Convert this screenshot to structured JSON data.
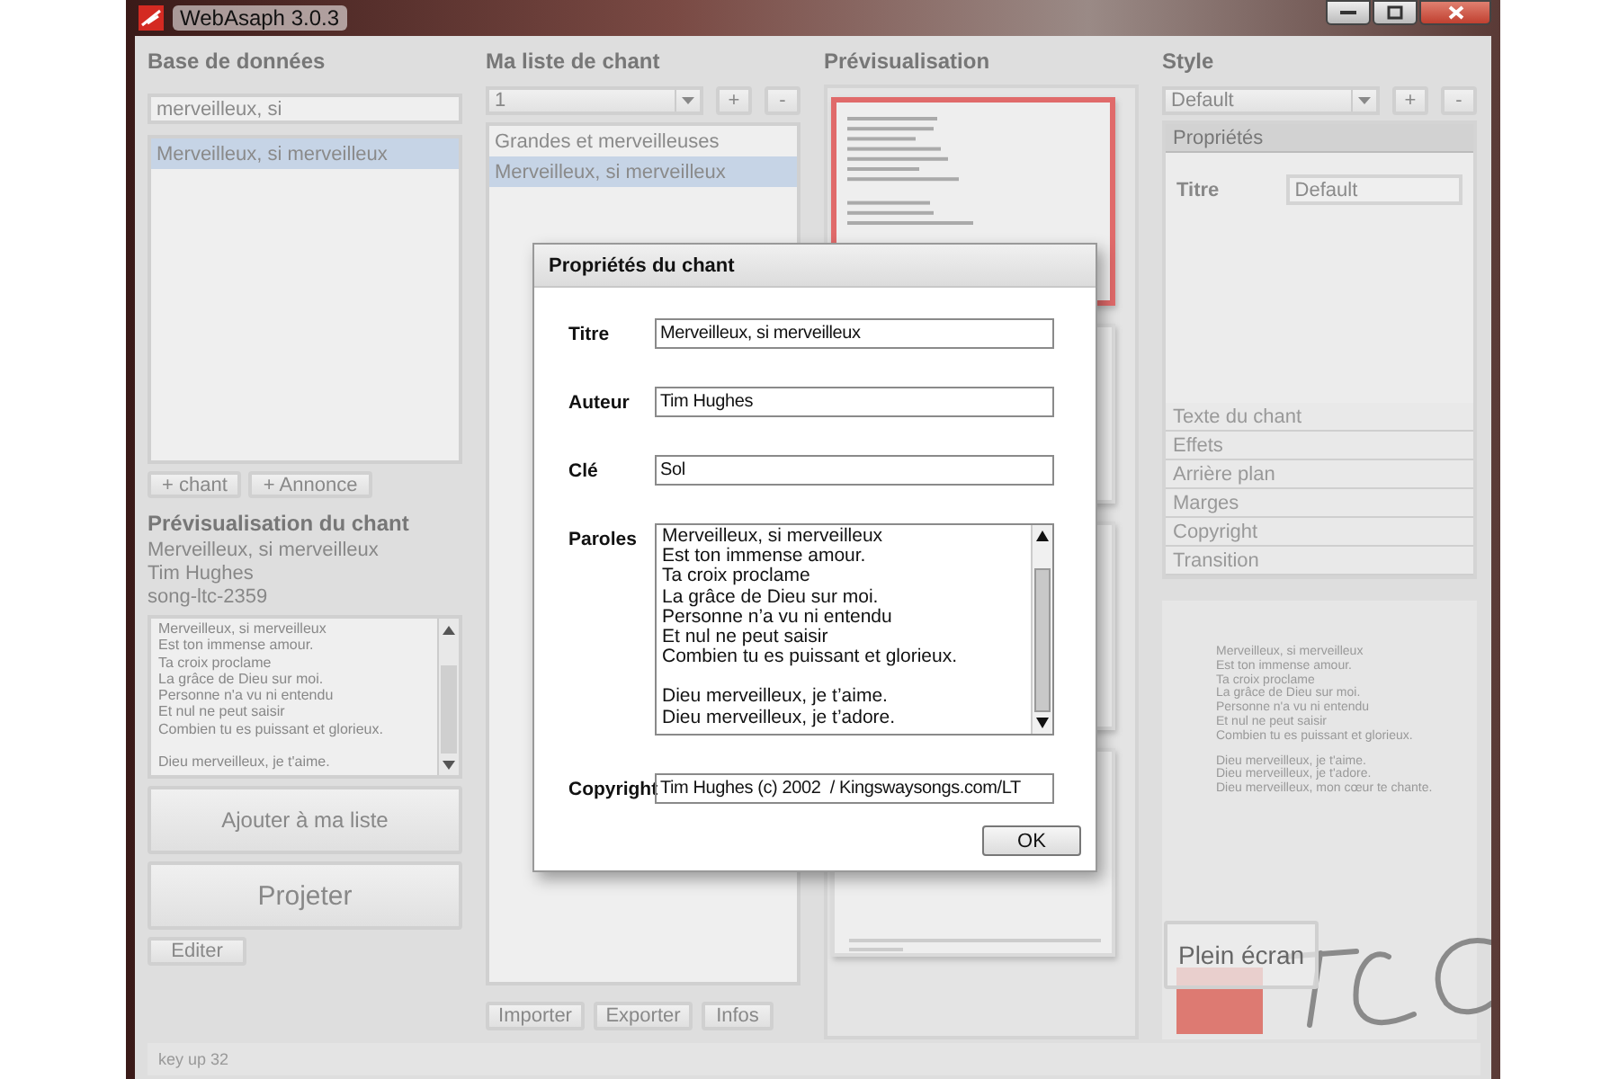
{
  "window": {
    "title": "WebAsaph 3.0.3"
  },
  "database": {
    "heading": "Base de données",
    "search": {
      "value": "merveilleux, si"
    },
    "results": [
      {
        "label": "Merveilleux, si merveilleux",
        "selected": true
      }
    ],
    "buttons": [
      "+ chant",
      "+ Annonce"
    ]
  },
  "song_preview": {
    "heading": "Prévisualisation du chant",
    "title": "Merveilleux, si merveilleux",
    "author": "Tim Hughes",
    "reference": "song-ltc-2359",
    "lyrics": [
      [
        "Merveilleux, si merveilleux",
        "Est ton immense amour.",
        "Ta croix proclame",
        "La grâce de Dieu sur moi.",
        "Personne n'a vu ni entendu",
        "Et nul ne peut saisir",
        "Combien tu es puissant et glorieux."
      ],
      [
        "Dieu merveilleux, je t'aime."
      ]
    ]
  },
  "actions": {
    "add": "Ajouter à ma liste",
    "project": "Projeter",
    "edit": "Editer"
  },
  "setlist": {
    "heading": "Ma liste de chant",
    "dropdown": "1",
    "add_button": "+",
    "remove_button": "-",
    "items": [
      {
        "label": "Grandes et merveilleuses",
        "selected": false
      },
      {
        "label": "Merveilleux, si merveilleux",
        "selected": true
      }
    ],
    "buttons": [
      "Importer",
      "Exporter",
      "Infos"
    ]
  },
  "preview": {
    "heading": "Prévisualisation",
    "slides": [
      {
        "selected": true
      },
      {
        "selected": false
      },
      {
        "selected": false
      },
      {
        "selected": false
      }
    ]
  },
  "style": {
    "heading": "Style",
    "dropdown": "Default",
    "add_button": "+",
    "remove_button": "-",
    "sections": [
      {
        "label": "Propriétés",
        "expanded": true
      },
      {
        "label": "Texte du chant",
        "expanded": false
      },
      {
        "label": "Effets",
        "expanded": false
      },
      {
        "label": "Arrière plan",
        "expanded": false
      },
      {
        "label": "Marges",
        "expanded": false
      },
      {
        "label": "Copyright",
        "expanded": false
      },
      {
        "label": "Transition",
        "expanded": false
      }
    ],
    "title_label": "Titre",
    "title_value": "Default",
    "preview_lyrics": [
      [
        "Merveilleux, si merveilleux",
        "Est ton immense amour.",
        "Ta croix proclame",
        "La grâce de Dieu sur moi.",
        "Personne n'a vu ni entendu",
        "Et nul ne peut saisir",
        "Combien tu es puissant et glorieux."
      ],
      [
        "Dieu merveilleux, je t'aime.",
        "Dieu merveilleux, je t'adore.",
        "Dieu merveilleux, mon cœur te chante."
      ]
    ],
    "fullscreen_button": "Plein écran"
  },
  "status_bar": "key up 32",
  "dialog": {
    "title": "Propriétés du chant",
    "fields": [
      {
        "kind": "line",
        "label": "Titre",
        "value": "Merveilleux, si merveilleux"
      },
      {
        "kind": "line",
        "label": "Auteur",
        "value": "Tim Hughes"
      },
      {
        "kind": "line",
        "label": "Clé",
        "value": "Sol"
      },
      {
        "kind": "text",
        "label": "Paroles",
        "stanzas": [
          [
            "Merveilleux, si merveilleux",
            "Est ton immense amour.",
            "Ta croix proclame",
            "La grâce de Dieu sur moi.",
            "Personne n’a vu ni entendu",
            "Et nul ne peut saisir",
            "Combien tu es puissant et glorieux."
          ],
          [
            "Dieu merveilleux, je t’aime.",
            "Dieu merveilleux, je t’adore."
          ]
        ]
      },
      {
        "kind": "line",
        "label": "Copyright",
        "value": "Tim Hughes (c) 2002  / Kingswaysongs.com/LT"
      }
    ],
    "ok": "OK"
  }
}
